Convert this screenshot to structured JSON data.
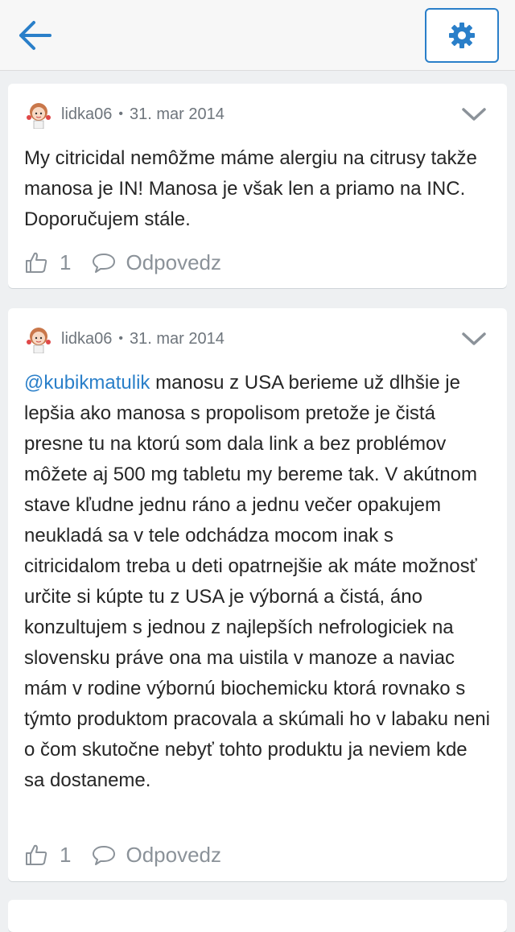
{
  "header": {
    "back_icon": "arrow-left-icon",
    "settings_icon": "gear-icon",
    "accent_color": "#2a7fc9"
  },
  "comments": [
    {
      "author": "lidka06",
      "separator": "•",
      "date": "31. mar 2014",
      "mention": "",
      "text": "My citricidal nemôžme máme alergiu na citrusy takže manosa je IN! Manosa je však len a priamo na INC. Doporučujem stále.",
      "likes": "1",
      "reply_label": "Odpovedz"
    },
    {
      "author": "lidka06",
      "separator": "•",
      "date": "31. mar 2014",
      "mention": "@kubikmatulik",
      "text": " manosu z USA berieme už dlhšie je lepšia ako manosa s propolisom pretože je čistá presne tu na ktorú som dala link a bez problémov môžete aj 500 mg tabletu my bereme tak. V akútnom stave kľudne jednu ráno a jednu večer opakujem neukladá sa v tele odchádza mocom inak s citricidalom treba u deti opatrnejšie ak máte možnosť určite si kúpte tu z USA je výborná a čistá, áno konzultujem s jednou z najlepších nefrologiciek na slovensku práve ona ma uistila v manoze a naviac mám v rodine výbornú biochemicku ktorá rovnako s týmto produktom pracovala a skúmali ho v labaku neni o čom skutočne nebyť tohto produktu ja neviem kde sa dostaneme.",
      "likes": "1",
      "reply_label": "Odpovedz"
    }
  ]
}
